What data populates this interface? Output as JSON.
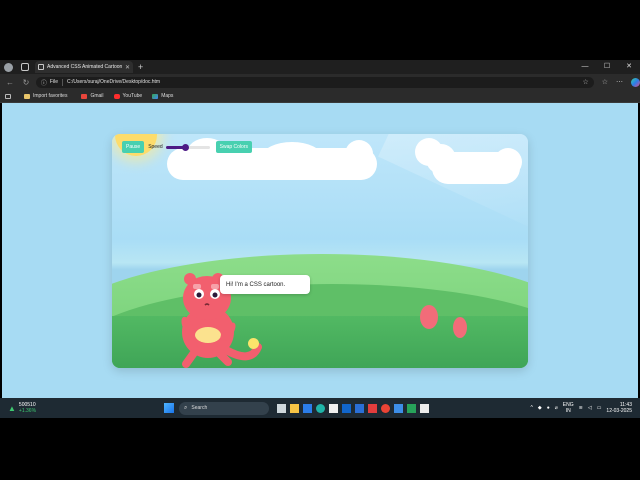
{
  "browser": {
    "tab_title": "Advanced CSS Animated Cartoon",
    "address_prefix": "File",
    "address_path": "C:/Users/suraj/OneDrive/Desktop/doc.htm",
    "bookmarks": [
      "Import favorites",
      "Gmail",
      "YouTube",
      "Maps"
    ]
  },
  "page": {
    "pause_label": "Pause",
    "speed_label": "Speed",
    "speed_value": 0.45,
    "swap_label": "Swap Colors",
    "speech": "Hi! I'm a CSS cartoon."
  },
  "taskbar": {
    "stock_name": "500510",
    "stock_change": "+1.36%",
    "search_placeholder": "Search",
    "lang_top": "ENG",
    "lang_bottom": "IN",
    "time": "11:43",
    "date": "12-03-2025"
  },
  "colors": {
    "accent_button": "#48d0b0",
    "slider": "#4d1b86",
    "cartoon": "#f25f6e"
  }
}
